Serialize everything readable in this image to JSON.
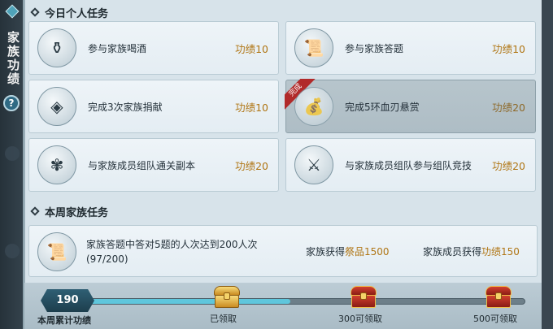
{
  "sidebar": {
    "title": "家族功绩",
    "help": "?"
  },
  "daily": {
    "heading": "今日个人任务",
    "tasks": [
      {
        "label": "参与家族喝酒",
        "merit": "功绩10",
        "icon": "wine-jug-icon",
        "done": false
      },
      {
        "label": "参与家族答题",
        "merit": "功绩10",
        "icon": "scroll-icon",
        "done": false
      },
      {
        "label": "完成3次家族捐献",
        "merit": "功绩10",
        "icon": "gem-pouch-icon",
        "done": false
      },
      {
        "label": "完成5环血刃悬赏",
        "merit": "功绩20",
        "icon": "money-bag-icon",
        "done": true,
        "ribbon": "完成"
      },
      {
        "label": "与家族成员组队通关副本",
        "merit": "功绩20",
        "icon": "emblem-icon",
        "done": false
      },
      {
        "label": "与家族成员组队参与组队竞技",
        "merit": "功绩20",
        "icon": "sword-icon",
        "done": false
      }
    ]
  },
  "weekly": {
    "heading": "本周家族任务",
    "task": {
      "description": "家族答题中答对5题的人次达到200人次",
      "progress_text": "(97/200)",
      "reward1_prefix": "家族获得",
      "reward1_value": "祭品1500",
      "reward2_prefix": "家族成员获得",
      "reward2_value": "功绩150",
      "icon": "scroll-icon"
    }
  },
  "progress": {
    "score": "190",
    "score_label": "本周累计功绩",
    "fill_fraction": 0.48,
    "chests": [
      {
        "label": "已领取",
        "style": "gold"
      },
      {
        "label": "300可领取",
        "style": "red"
      },
      {
        "label": "500可领取",
        "style": "red"
      }
    ]
  },
  "colors": {
    "accent": "#b07615",
    "progress_fill": "#5fc6dc",
    "done_ribbon": "#b12a2a"
  }
}
